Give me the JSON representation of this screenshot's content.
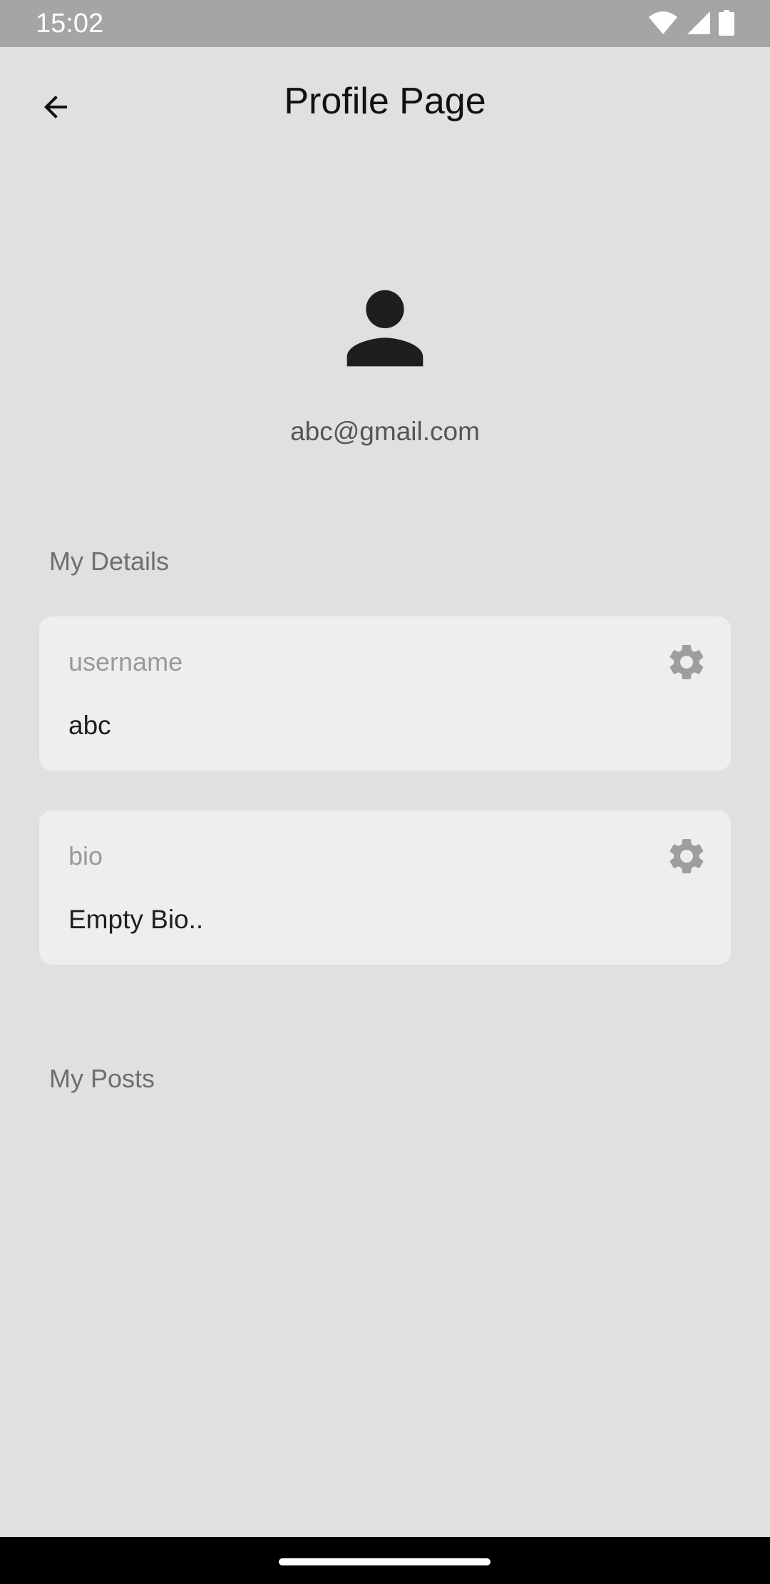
{
  "status_bar": {
    "time": "15:02",
    "icons": [
      "wifi-icon",
      "signal-icon",
      "battery-icon"
    ]
  },
  "app_bar": {
    "title": "Profile Page",
    "back_icon": "arrow-back-icon"
  },
  "profile": {
    "avatar_icon": "person-icon",
    "email": "abc@gmail.com"
  },
  "details": {
    "heading": "My Details",
    "username": {
      "label": "username",
      "value": "abc",
      "icon": "gear-icon"
    },
    "bio": {
      "label": "bio",
      "value": "Empty Bio..",
      "icon": "gear-icon"
    }
  },
  "posts": {
    "heading": "My Posts"
  },
  "colors": {
    "background": "#e0e0e0",
    "card": "#eeeeee",
    "status_bar": "#a5a5a5",
    "nav_bar": "#000000",
    "icon_gray": "#9e9e9e"
  }
}
